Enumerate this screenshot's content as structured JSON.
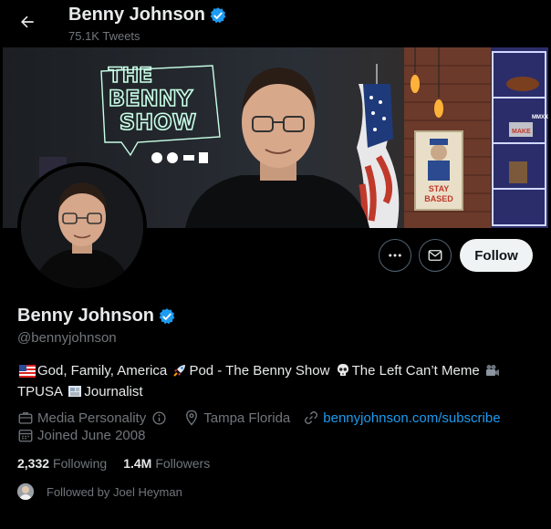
{
  "header": {
    "name": "Benny Johnson",
    "tweets_count": "75.1K Tweets",
    "back_icon": "arrow-left-icon"
  },
  "banner": {
    "neon_lines": [
      "THE",
      "BENNY",
      "SHOW"
    ],
    "sign_lines": [
      "STAY",
      "BASED"
    ],
    "mini_labels": [
      "MAKE",
      "MMXX"
    ],
    "icons": [
      "apple-podcasts-icon",
      "spotify-icon",
      "google-podcasts-icon",
      "iheart-icon"
    ]
  },
  "profile": {
    "name": "Benny Johnson",
    "handle": "@bennyjohnson",
    "bio_line1_parts": [
      "God, Family, America",
      "Pod - The Benny Show",
      "The Left Can’t Meme"
    ],
    "bio_line2_parts": [
      "TPUSA",
      "Journalist"
    ],
    "category": "Media Personality",
    "location": "Tampa Florida",
    "website": "bennyjohnson.com/subscribe",
    "joined": "Joined June 2008",
    "following_count": "2,332",
    "following_label": "Following",
    "followers_count": "1.4M",
    "followers_label": "Followers",
    "followed_by": "Followed by Joel Heyman"
  },
  "actions": {
    "follow_label": "Follow",
    "more_icon": "more-icon",
    "message_icon": "envelope-icon"
  },
  "colors": {
    "background": "#000000",
    "accent": "#1d9bf0",
    "text": "#e7e9ea",
    "muted": "#71767b",
    "follow_bg": "#eff3f4"
  }
}
